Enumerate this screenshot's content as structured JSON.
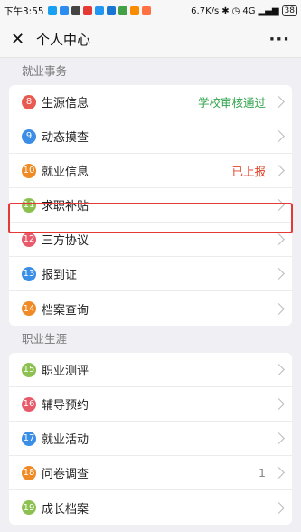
{
  "status_bar": {
    "time": "下午3:55",
    "speed": "6.7K/s",
    "network": "4G",
    "battery": "38"
  },
  "header": {
    "close_icon": "close-icon",
    "title": "个人中心",
    "more_icon": "more-icon"
  },
  "sections": [
    {
      "title": "就业事务",
      "items": [
        {
          "num": "8",
          "label": "生源信息",
          "value": "学校审核通过",
          "value_color": "#2fa34a",
          "color": "#e85a4f"
        },
        {
          "num": "9",
          "label": "动态摸查",
          "value": "",
          "color": "#3a8ee6"
        },
        {
          "num": "10",
          "label": "就业信息",
          "value": "已上报",
          "value_color": "#e0452a",
          "color": "#f08a24"
        },
        {
          "num": "11",
          "label": "求职补贴",
          "value": "",
          "color": "#8cc152"
        },
        {
          "num": "12",
          "label": "三方协议",
          "value": "",
          "color": "#e85a6a"
        },
        {
          "num": "13",
          "label": "报到证",
          "value": "",
          "color": "#3a8ee6"
        },
        {
          "num": "14",
          "label": "档案查询",
          "value": "",
          "color": "#f08a24"
        }
      ]
    },
    {
      "title": "职业生涯",
      "items": [
        {
          "num": "15",
          "label": "职业测评",
          "value": "",
          "color": "#8cc152"
        },
        {
          "num": "16",
          "label": "辅导预约",
          "value": "",
          "color": "#e85a6a"
        },
        {
          "num": "17",
          "label": "就业活动",
          "value": "",
          "color": "#3a8ee6"
        },
        {
          "num": "18",
          "label": "问卷调查",
          "value": "1",
          "value_color": "#888888",
          "color": "#f08a24"
        },
        {
          "num": "19",
          "label": "成长档案",
          "value": "",
          "color": "#8cc152"
        }
      ]
    }
  ]
}
